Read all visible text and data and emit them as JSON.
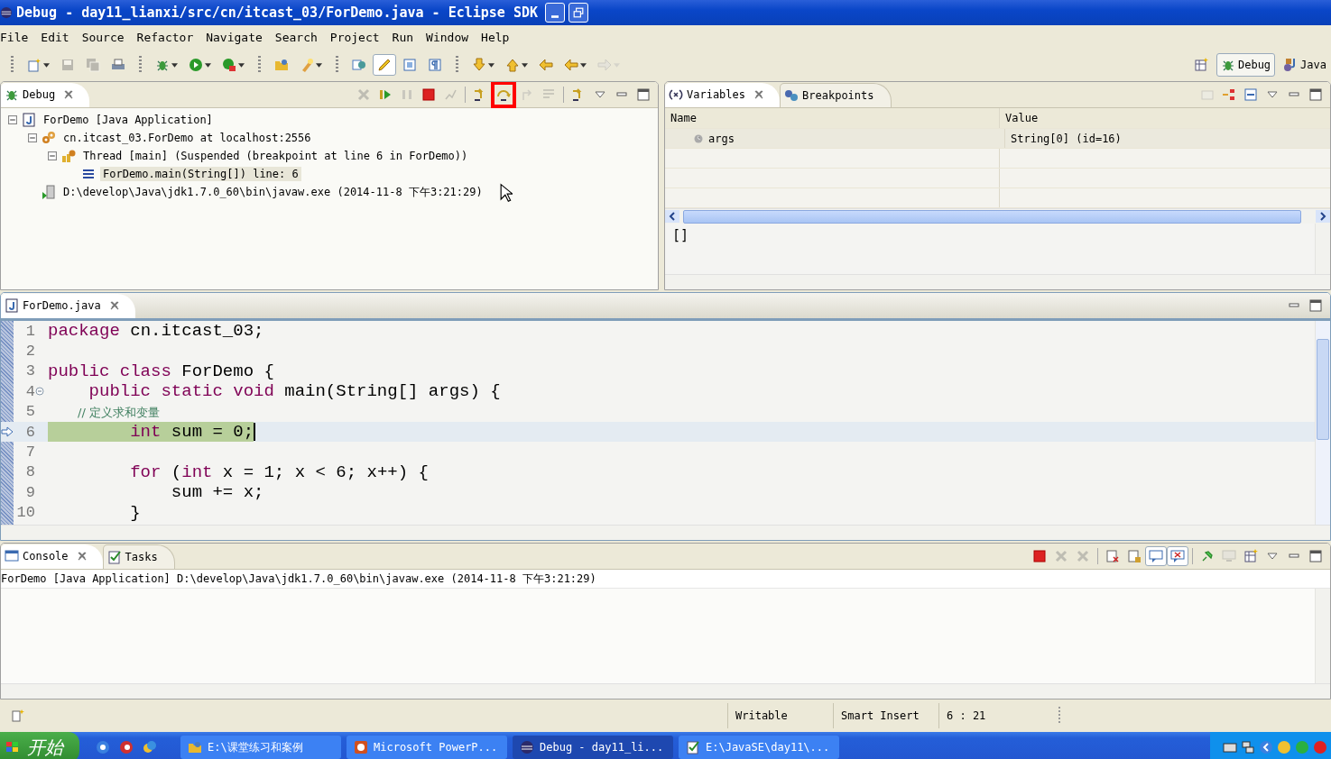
{
  "window": {
    "title": "Debug - day11_lianxi/src/cn/itcast_03/ForDemo.java - Eclipse SDK"
  },
  "menu": [
    "File",
    "Edit",
    "Source",
    "Refactor",
    "Navigate",
    "Search",
    "Project",
    "Run",
    "Window",
    "Help"
  ],
  "toolbar": [
    {
      "kind": "grip"
    },
    {
      "kind": "new",
      "dropdown": true,
      "disabled": false,
      "pressed": false
    },
    {
      "kind": "save",
      "dropdown": false,
      "disabled": true,
      "pressed": false
    },
    {
      "kind": "save-all",
      "dropdown": false,
      "disabled": true,
      "pressed": false
    },
    {
      "kind": "print",
      "dropdown": false,
      "disabled": false,
      "pressed": false
    },
    {
      "kind": "grip"
    },
    {
      "kind": "debug",
      "dropdown": true,
      "disabled": false,
      "pressed": false
    },
    {
      "kind": "run",
      "dropdown": true,
      "disabled": false,
      "pressed": false
    },
    {
      "kind": "external",
      "dropdown": true,
      "disabled": false,
      "pressed": false
    },
    {
      "kind": "grip"
    },
    {
      "kind": "open-type",
      "dropdown": false,
      "disabled": false,
      "pressed": false
    },
    {
      "kind": "search",
      "dropdown": true,
      "disabled": false,
      "pressed": false
    },
    {
      "kind": "grip"
    },
    {
      "kind": "open-task",
      "dropdown": false,
      "disabled": false,
      "pressed": false
    },
    {
      "kind": "highlight",
      "dropdown": false,
      "disabled": false,
      "pressed": true
    },
    {
      "kind": "block",
      "dropdown": false,
      "disabled": false,
      "pressed": false
    },
    {
      "kind": "pilcrow",
      "dropdown": false,
      "disabled": false,
      "pressed": false
    },
    {
      "kind": "grip"
    },
    {
      "kind": "next-annot",
      "dropdown": true,
      "disabled": false,
      "pressed": false
    },
    {
      "kind": "prev-annot",
      "dropdown": true,
      "disabled": false,
      "pressed": false
    },
    {
      "kind": "last-edit",
      "dropdown": false,
      "disabled": false,
      "pressed": false
    },
    {
      "kind": "back",
      "dropdown": true,
      "disabled": false,
      "pressed": false
    },
    {
      "kind": "forward",
      "dropdown": true,
      "disabled": true,
      "pressed": false
    }
  ],
  "perspectives": [
    {
      "kind": "open-persp",
      "selected": false
    },
    {
      "kind": "debug",
      "label": "Debug",
      "selected": true
    },
    {
      "kind": "java",
      "label": "Java",
      "selected": false
    }
  ],
  "debug_view": {
    "tabs": [
      {
        "label": "Debug",
        "kind": "debug",
        "selected": true,
        "closable": true
      }
    ],
    "tools": [
      {
        "kind": "remove",
        "disabled": true,
        "highlighted": false
      },
      {
        "kind": "resume",
        "disabled": false,
        "highlighted": false
      },
      {
        "kind": "suspend",
        "disabled": true,
        "highlighted": false
      },
      {
        "kind": "terminate",
        "disabled": false,
        "highlighted": false
      },
      {
        "kind": "disconnect",
        "disabled": true,
        "highlighted": false
      },
      {
        "kind": "sep"
      },
      {
        "kind": "step-into",
        "disabled": false,
        "highlighted": false
      },
      {
        "kind": "step-over",
        "disabled": false,
        "highlighted": true
      },
      {
        "kind": "step-return",
        "disabled": true,
        "highlighted": false
      },
      {
        "kind": "drop-frame",
        "disabled": true,
        "highlighted": false
      },
      {
        "kind": "sep"
      },
      {
        "kind": "step-filters",
        "disabled": false,
        "highlighted": false
      },
      {
        "kind": "view-menu",
        "disabled": false,
        "highlighted": false
      },
      {
        "kind": "minimize",
        "disabled": false,
        "highlighted": false
      },
      {
        "kind": "maximize",
        "disabled": false,
        "highlighted": false
      }
    ],
    "tree": [
      {
        "kind": "launch",
        "label": "ForDemo [Java Application]",
        "expanded": true,
        "selected": false,
        "children": [
          {
            "kind": "target",
            "label": "cn.itcast_03.ForDemo at localhost:2556",
            "expanded": true,
            "selected": false,
            "children": [
              {
                "kind": "thread",
                "label": "Thread [main] (Suspended (breakpoint at line 6 in ForDemo))",
                "expanded": true,
                "selected": false,
                "children": [
                  {
                    "kind": "frame",
                    "label": "ForDemo.main(String[]) line: 6",
                    "selected": true
                  }
                ]
              }
            ]
          },
          {
            "kind": "process",
            "label": "D:\\develop\\Java\\jdk1.7.0_60\\bin\\javaw.exe (2014-11-8 下午3:21:29)",
            "selected": false
          }
        ]
      }
    ]
  },
  "variables_view": {
    "tabs": [
      {
        "label": "Variables",
        "kind": "variables",
        "selected": true,
        "closable": true
      },
      {
        "label": "Breakpoints",
        "kind": "breakpoints",
        "selected": false,
        "closable": false
      }
    ],
    "tools": [
      {
        "kind": "show-type",
        "disabled": true,
        "highlighted": false
      },
      {
        "kind": "logical",
        "disabled": false,
        "highlighted": false
      },
      {
        "kind": "collapse-all",
        "disabled": false,
        "highlighted": false
      },
      {
        "kind": "view-menu",
        "disabled": false,
        "highlighted": false
      },
      {
        "kind": "minimize",
        "disabled": false,
        "highlighted": false
      },
      {
        "kind": "maximize",
        "disabled": false,
        "highlighted": false
      }
    ],
    "columns": [
      "Name",
      "Value"
    ],
    "rows": [
      {
        "name": "args",
        "value": "String[0]  (id=16)",
        "selected": true
      }
    ],
    "detail": "[]"
  },
  "editor": {
    "tabs": [
      {
        "label": "ForDemo.java",
        "kind": "java-file",
        "selected": true,
        "closable": true
      }
    ],
    "lines": [
      {
        "number": "1",
        "tokens": [
          {
            "kind": "keyword",
            "text": "package"
          },
          {
            "kind": "plain",
            "text": " cn.itcast_03;"
          }
        ]
      },
      {
        "number": "2"
      },
      {
        "number": "3",
        "tokens": [
          {
            "kind": "keyword",
            "text": "public class"
          },
          {
            "kind": "plain",
            "text": " ForDemo {"
          }
        ]
      },
      {
        "number": "4",
        "fold": true,
        "tokens": [
          {
            "kind": "keyword",
            "text": "    public static void"
          },
          {
            "kind": "plain",
            "text": " main(String[] args) {"
          }
        ]
      },
      {
        "number": "5",
        "tokens": [
          {
            "kind": "comment",
            "text": "        // 定义求和变量"
          }
        ]
      },
      {
        "number": "6",
        "current": true,
        "tokens": [
          {
            "kind": "keyword",
            "text": "        int"
          },
          {
            "kind": "plain",
            "text": " sum = 0;"
          }
        ]
      },
      {
        "number": "7"
      },
      {
        "number": "8",
        "tokens": [
          {
            "kind": "keyword",
            "text": "        for"
          },
          {
            "kind": "plain",
            "text": " ("
          },
          {
            "kind": "keyword",
            "text": "int"
          },
          {
            "kind": "plain",
            "text": " x = 1; x < 6; x++) {"
          }
        ]
      },
      {
        "number": "9",
        "tokens": [
          {
            "kind": "plain",
            "text": "            sum += x;"
          }
        ]
      },
      {
        "number": "10",
        "tokens": [
          {
            "kind": "plain",
            "text": "        }"
          }
        ]
      }
    ]
  },
  "console_view": {
    "tabs": [
      {
        "label": "Console",
        "kind": "console",
        "selected": true,
        "closable": true
      },
      {
        "label": "Tasks",
        "kind": "tasks",
        "selected": false,
        "closable": false
      }
    ],
    "tools": [
      {
        "kind": "terminate",
        "disabled": false,
        "highlighted": false,
        "pressed": false
      },
      {
        "kind": "remove",
        "disabled": true,
        "highlighted": false,
        "pressed": false
      },
      {
        "kind": "remove-all",
        "disabled": true,
        "highlighted": false,
        "pressed": false
      },
      {
        "kind": "sep"
      },
      {
        "kind": "clear",
        "disabled": false,
        "highlighted": false,
        "pressed": false
      },
      {
        "kind": "scroll-lock",
        "disabled": false,
        "highlighted": false,
        "pressed": false
      },
      {
        "kind": "stdout",
        "disabled": false,
        "highlighted": false,
        "pressed": true
      },
      {
        "kind": "stderr",
        "disabled": false,
        "highlighted": false,
        "pressed": true
      },
      {
        "kind": "sep"
      },
      {
        "kind": "pin",
        "disabled": false,
        "highlighted": false,
        "pressed": false
      },
      {
        "kind": "display",
        "disabled": true,
        "highlighted": false,
        "pressed": false
      },
      {
        "kind": "open-console",
        "disabled": false,
        "highlighted": false,
        "pressed": false
      },
      {
        "kind": "view-menu",
        "disabled": false,
        "highlighted": false,
        "pressed": false
      },
      {
        "kind": "minimize",
        "disabled": false,
        "highlighted": false,
        "pressed": false
      },
      {
        "kind": "maximize",
        "disabled": false,
        "highlighted": false,
        "pressed": false
      }
    ],
    "header": "ForDemo [Java Application] D:\\develop\\Java\\jdk1.7.0_60\\bin\\javaw.exe (2014-11-8 下午3:21:29)"
  },
  "status_bar": [
    "Writable",
    "Smart Insert",
    "6 : 21"
  ],
  "taskbar": {
    "start": "开始",
    "tasks": [
      {
        "kind": "folder",
        "label": "E:\\课堂练习和案例",
        "selected": false
      },
      {
        "kind": "powerpoint",
        "label": "Microsoft PowerP...",
        "selected": false
      },
      {
        "kind": "eclipse",
        "label": "Debug - day11_li...",
        "selected": true
      },
      {
        "kind": "notepad",
        "label": "E:\\JavaSE\\day11\\...",
        "selected": false
      }
    ]
  }
}
